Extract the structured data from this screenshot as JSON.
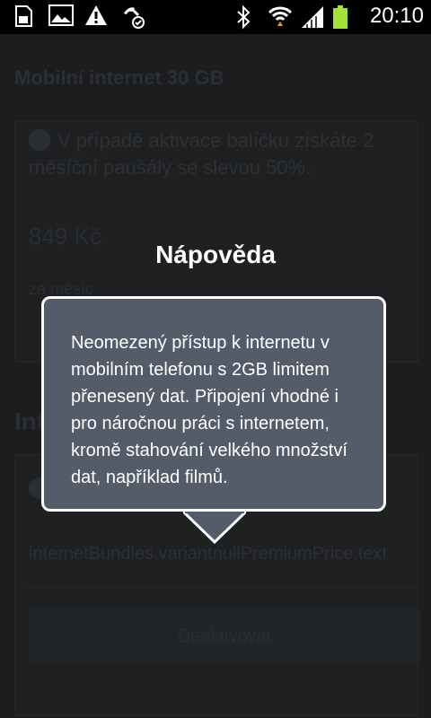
{
  "status_bar": {
    "time": "20:10",
    "icons": [
      "sd-card-icon",
      "image-icon",
      "warning-icon",
      "call-forward-icon",
      "bluetooth-icon",
      "wifi-icon",
      "signal-icon",
      "battery-icon"
    ],
    "battery_color": "#a6e13a"
  },
  "background": {
    "title": "Mobilní internet 30 GB",
    "info_text": "V případě aktivace balíčku získáte 2 měsíční paušály se slevou 50%.",
    "price": "849 Kč",
    "price_period": "za měsíc",
    "section_heading": "Int",
    "premium_price": "internetBundles.variantnullPremiumPrice.text",
    "deactivate_label": "Deaktivovat"
  },
  "tooltip": {
    "title": "Nápověda",
    "text": "Neomezený přístup k internetu v mobilním telefonu s 2GB limitem přenesený dat. Připojení vhodné i pro náročnou práci s internetem, kromě stahování velkého množství dat, například filmů."
  }
}
